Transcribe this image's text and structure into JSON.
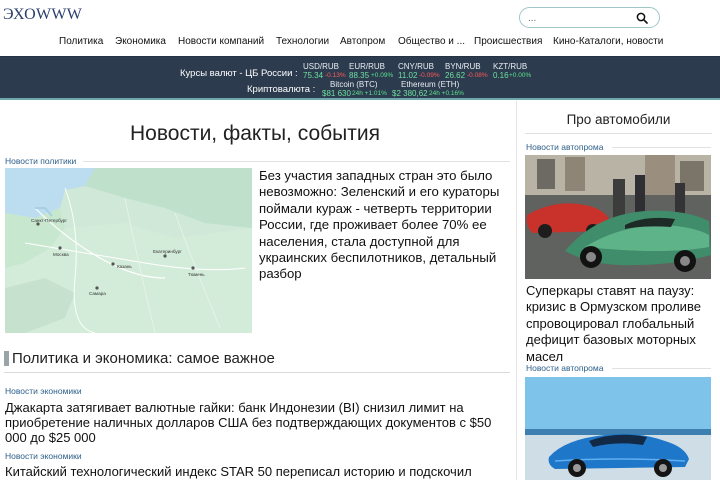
{
  "header": {
    "logo": "ЭХОWWW",
    "search_placeholder": "...",
    "search_icon": "search-icon"
  },
  "nav": {
    "items": [
      {
        "label": "Политика"
      },
      {
        "label": "Экономика"
      },
      {
        "label": "Новости компаний"
      },
      {
        "label": "Технологии"
      },
      {
        "label": "Автопром"
      },
      {
        "label": "Общество и ..."
      },
      {
        "label": "Происшествия"
      },
      {
        "label": "Кино-Каталоги, новости"
      }
    ]
  },
  "ticker": {
    "rates_label": "Курсы валют - ЦБ России :",
    "crypto_label": "Криптовалюта :",
    "rates": [
      {
        "code": "USD/RUB",
        "value": "75.34",
        "change": "-0.13%",
        "direction": "down"
      },
      {
        "code": "EUR/RUB",
        "value": "88.35",
        "change": "+0.09%",
        "direction": "up"
      },
      {
        "code": "CNY/RUB",
        "value": "11.02",
        "change": "-0.09%",
        "direction": "down"
      },
      {
        "code": "BYN/RUB",
        "value": "26.62",
        "change": "-0.08%",
        "direction": "down"
      },
      {
        "code": "KZT/RUB",
        "value": "0.16",
        "change": "+0.00%",
        "direction": "up"
      }
    ],
    "crypto": [
      {
        "code": "Bitcoin (BTC)",
        "value": "$81 630",
        "change": "24h +1.01%",
        "direction": "up"
      },
      {
        "code": "Ethereum (ETH)",
        "value": "$2 380,62",
        "change": "24h +0.16%",
        "direction": "up"
      }
    ],
    "colors": {
      "background": "#2c3b4d",
      "up": "#59e28e",
      "down": "#ff5b5b",
      "value": "#6fe0a1"
    }
  },
  "main": {
    "title": "Новости, факты, события",
    "lead": {
      "category": "Новости политики",
      "image": "map-image",
      "map_labels": [
        "Санкт-Петербург",
        "Москва",
        "Казань",
        "Екатеринбург",
        "Самара",
        "Тюмень"
      ],
      "title": "Без участия западных стран это было невозможно: Зеленский и его кураторы поймали кураж - четверть территории России, где проживает более 70% ее населения, стала доступной для украинских беспилотников, детальный разбор"
    },
    "section_title": "Политика и экономика: самое важное",
    "articles": [
      {
        "category": "Новости экономики",
        "title": "Джакарта затягивает валютные гайки: банк Индонезии (BI) снизил лимит на приобретение наличных долларов США без подтверждающих документов с $50 000 до $25 000"
      },
      {
        "category": "Новости экономики",
        "title": "Китайский технологический индекс STAR 50 переписал историю и подскочил"
      }
    ]
  },
  "sidebar": {
    "title": "Про автомобили",
    "articles": [
      {
        "category": "Новости автопрома",
        "image": "supercars-image",
        "title": "Суперкары ставят на паузу: кризис в Ормузском проливе спровоцировал глобальный дефицит базовых моторных масел"
      },
      {
        "category": "Новости автопрома",
        "image": "blue-car-image"
      }
    ]
  },
  "accent_color": "#2d5f8a"
}
